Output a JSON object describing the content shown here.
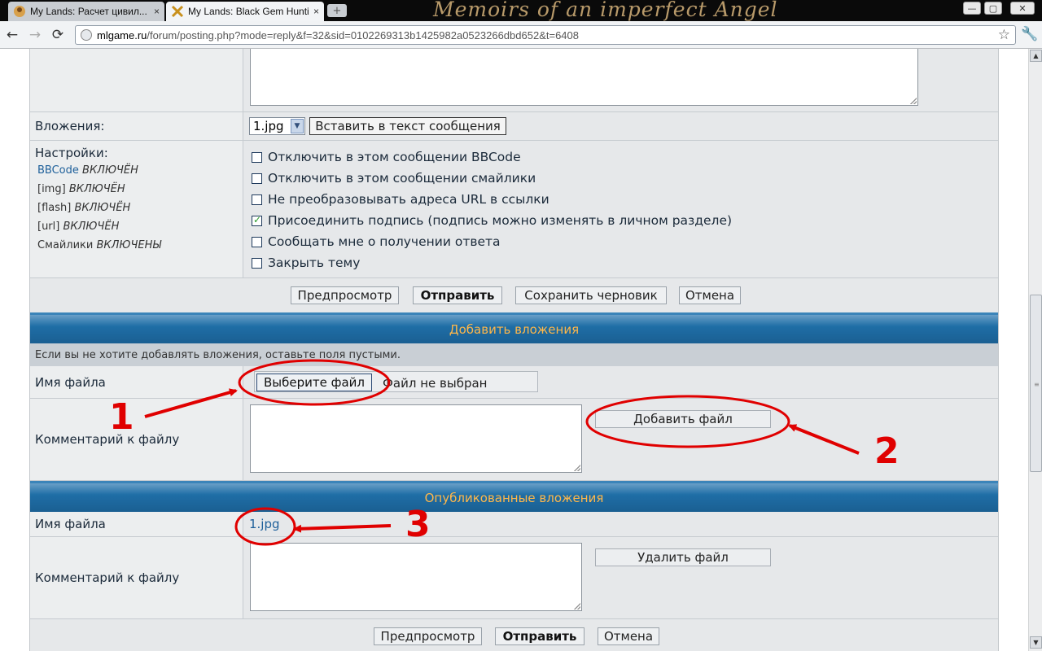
{
  "browser": {
    "tabs": [
      {
        "title": "My Lands: Расчет цивил...",
        "close": "×"
      },
      {
        "title": "My Lands: Black Gem Hunti...",
        "close": "×"
      }
    ],
    "new_tab": "+",
    "brand_text": "Memoirs of an imperfect Angel",
    "window_buttons": [
      "—",
      "▢",
      "✕"
    ],
    "nav": {
      "back": "←",
      "forward": "→",
      "reload": "⟳"
    },
    "url_host": "mlgame.ru",
    "url_path": "/forum/posting.php?mode=reply&f=32&sid=0102269313b1425982a0523266dbd652&t=6408",
    "star": "☆",
    "wrench": "🔧"
  },
  "attachments_row": {
    "label": "Вложения:",
    "select_value": "1.jpg",
    "insert_button": "Вставить в текст сообщения"
  },
  "settings": {
    "label": "Настройки:",
    "statuses": [
      {
        "name": "BBCode",
        "state": "ВКЛЮЧЁН",
        "link": true
      },
      {
        "name": "[img]",
        "state": "ВКЛЮЧЁН",
        "link": false
      },
      {
        "name": "[flash]",
        "state": "ВКЛЮЧЁН",
        "link": false
      },
      {
        "name": "[url]",
        "state": "ВКЛЮЧЁН",
        "link": false
      },
      {
        "name": "Смайлики",
        "state": "ВКЛЮЧЕНЫ",
        "link": false
      }
    ],
    "options": [
      {
        "label": "Отключить в этом сообщении BBCode",
        "checked": false
      },
      {
        "label": "Отключить в этом сообщении смайлики",
        "checked": false
      },
      {
        "label": "Не преобразовывать адреса URL в ссылки",
        "checked": false
      },
      {
        "label": "Присоединить подпись (подпись можно изменять в личном разделе)",
        "checked": true
      },
      {
        "label": "Сообщать мне о получении ответа",
        "checked": false
      },
      {
        "label": "Закрыть тему",
        "checked": false
      }
    ]
  },
  "actions_top": {
    "preview": "Предпросмотр",
    "submit": "Отправить",
    "save_draft": "Сохранить черновик",
    "cancel": "Отмена"
  },
  "add_attachments": {
    "header": "Добавить вложения",
    "info": "Если вы не хотите добавлять вложения, оставьте поля пустыми.",
    "filename_label": "Имя файла",
    "choose_file": "Выберите файл",
    "no_file": "Файл не выбран",
    "comment_label": "Комментарий к файлу",
    "add_file": "Добавить файл"
  },
  "posted_attachments": {
    "header": "Опубликованные вложения",
    "filename_label": "Имя файла",
    "file_link": "1.jpg",
    "comment_label": "Комментарий к файлу",
    "delete_file": "Удалить файл"
  },
  "actions_bottom": {
    "preview": "Предпросмотр",
    "submit": "Отправить",
    "cancel": "Отмена"
  },
  "annotations": {
    "numbers": [
      "1",
      "2",
      "3"
    ],
    "color": "#e00000"
  },
  "scrollbar": {
    "up": "▲",
    "down": "▼",
    "grip": "≡"
  }
}
